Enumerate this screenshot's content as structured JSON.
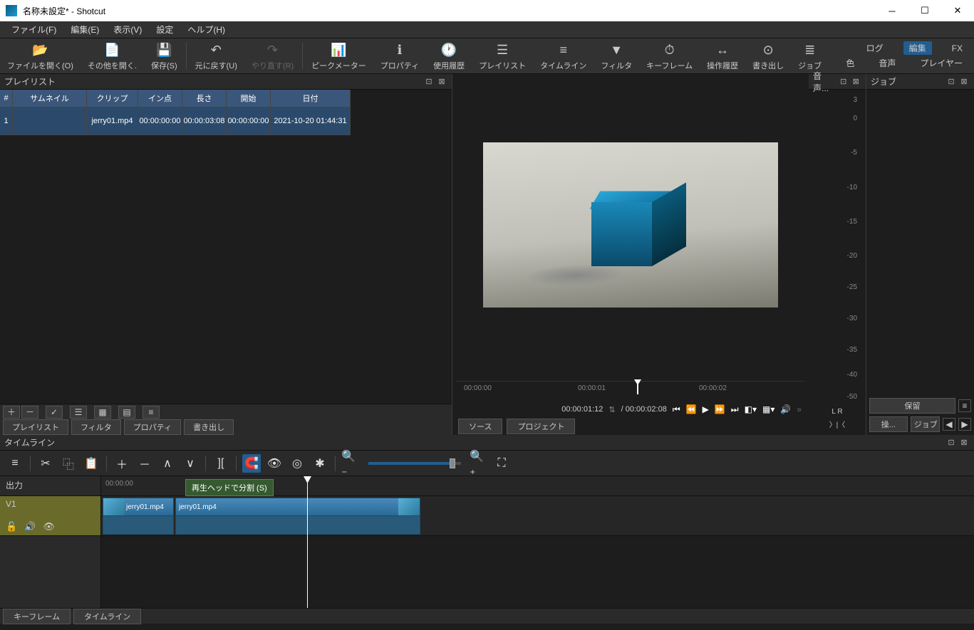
{
  "window": {
    "title": "名称未設定* - Shotcut"
  },
  "menu": {
    "file": "ファイル(F)",
    "edit": "編集(E)",
    "view": "表示(V)",
    "settings": "設定",
    "help": "ヘルプ(H)"
  },
  "toolbar": {
    "open": "ファイルを開く(O)",
    "openother": "その他を開く.",
    "save": "保存(S)",
    "undo": "元に戻す(U)",
    "redo": "やり直す(R)",
    "peakmeter": "ピークメーター",
    "properties": "プロパティ",
    "history": "使用履歴",
    "playlist": "プレイリスト",
    "timeline": "タイムライン",
    "filters": "フィルタ",
    "keyframes": "キーフレーム",
    "ophistory": "操作履歴",
    "export": "書き出し",
    "job": "ジョブ"
  },
  "topright": {
    "log": "ログ",
    "edit": "編集",
    "fx": "FX",
    "color": "色",
    "audio": "音声",
    "player": "プレイヤー"
  },
  "playlist": {
    "title": "プレイリスト",
    "cols": {
      "idx": "#",
      "thumb": "サムネイル",
      "clip": "クリップ",
      "in": "イン点",
      "len": "長さ",
      "start": "開始",
      "date": "日付"
    },
    "rows": [
      {
        "idx": "1",
        "clip": "jerry01.mp4",
        "in": "00:00:00:00",
        "len": "00:00:03:08",
        "start": "00:00:00:00",
        "date": "2021-10-20 01:44:31"
      }
    ],
    "tabs": {
      "playlist": "プレイリスト",
      "filters": "フィルタ",
      "properties": "プロパティ",
      "export": "書き出し"
    }
  },
  "preview": {
    "ruler": {
      "t0": "00:00:00",
      "t1": "00:00:01",
      "t2": "00:00:02"
    },
    "timecode": "00:00:01:12",
    "duration": "/ 00:00:02:08",
    "tabs": {
      "source": "ソース",
      "project": "プロジェクト"
    }
  },
  "meter": {
    "title": "音声...",
    "levels": [
      "3",
      "0",
      "-5",
      "-10",
      "-15",
      "-20",
      "-25",
      "-30",
      "-35",
      "-40",
      "-50"
    ],
    "lr": "L  R"
  },
  "jobs": {
    "title": "ジョブ",
    "hold": "保留",
    "sou": "操...",
    "job": "ジョブ"
  },
  "timeline": {
    "title": "タイムライン",
    "tooltip": "再生ヘッドで分割 (S)",
    "output": "出力",
    "track": "V1",
    "ruler": {
      "t0": "00:00:00"
    },
    "clips": [
      {
        "name": "jerry01.mp4"
      },
      {
        "name": "jerry01.mp4"
      }
    ]
  },
  "bottomtabs": {
    "keyframes": "キーフレーム",
    "timeline": "タイムライン"
  }
}
